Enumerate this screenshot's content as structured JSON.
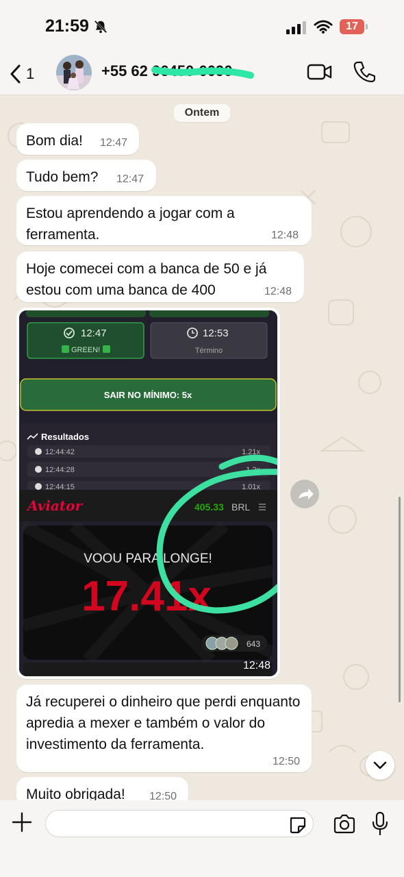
{
  "status_bar": {
    "time": "21:59",
    "battery": "17"
  },
  "header": {
    "back_count": "1",
    "contact_name": "+55 62 96450-0090"
  },
  "chat": {
    "date_chip": "Ontem",
    "messages": [
      {
        "text": "Bom dia!",
        "time": "12:47"
      },
      {
        "text": "Tudo bem?",
        "time": "12:47"
      },
      {
        "text": "Estou aprendendo a jogar com a ferramenta.",
        "time": "12:48"
      },
      {
        "text": "Hoje comecei com a banca de 50 e já estou com uma banca de 400",
        "time": "12:48"
      },
      {
        "text": "Já recuperei o dinheiro que perdi enquanto apredia a mexer e também o valor do investimento da ferramenta.",
        "time": "12:50"
      },
      {
        "text": "Muito obrigada!",
        "time": "12:50"
      }
    ],
    "image_message": {
      "time": "12:48",
      "signal_card_time": "12:47",
      "signal_card_status": "GREEN!",
      "end_card_time": "12:53",
      "end_card_label": "Término",
      "exit_button": "SAIR NO MÍNIMO: 5x",
      "results_title": "Resultados",
      "results": [
        {
          "time": "12:44:42",
          "mult": "1.21x"
        },
        {
          "time": "12:44:28",
          "mult": "1.2x"
        },
        {
          "time": "12:44:15",
          "mult": "1.01x"
        }
      ],
      "game_logo": "Aviator",
      "balance": "405.33",
      "currency": "BRL",
      "fly_text": "VOOU PARA LONGE!",
      "multiplier": "17.41x",
      "players": "643"
    }
  },
  "composer": {
    "placeholder": ""
  },
  "colors": {
    "accent_green": "#25d366",
    "aviator_red": "#e50539",
    "balance_green": "#28a909",
    "circle_green": "#3de0a0"
  }
}
